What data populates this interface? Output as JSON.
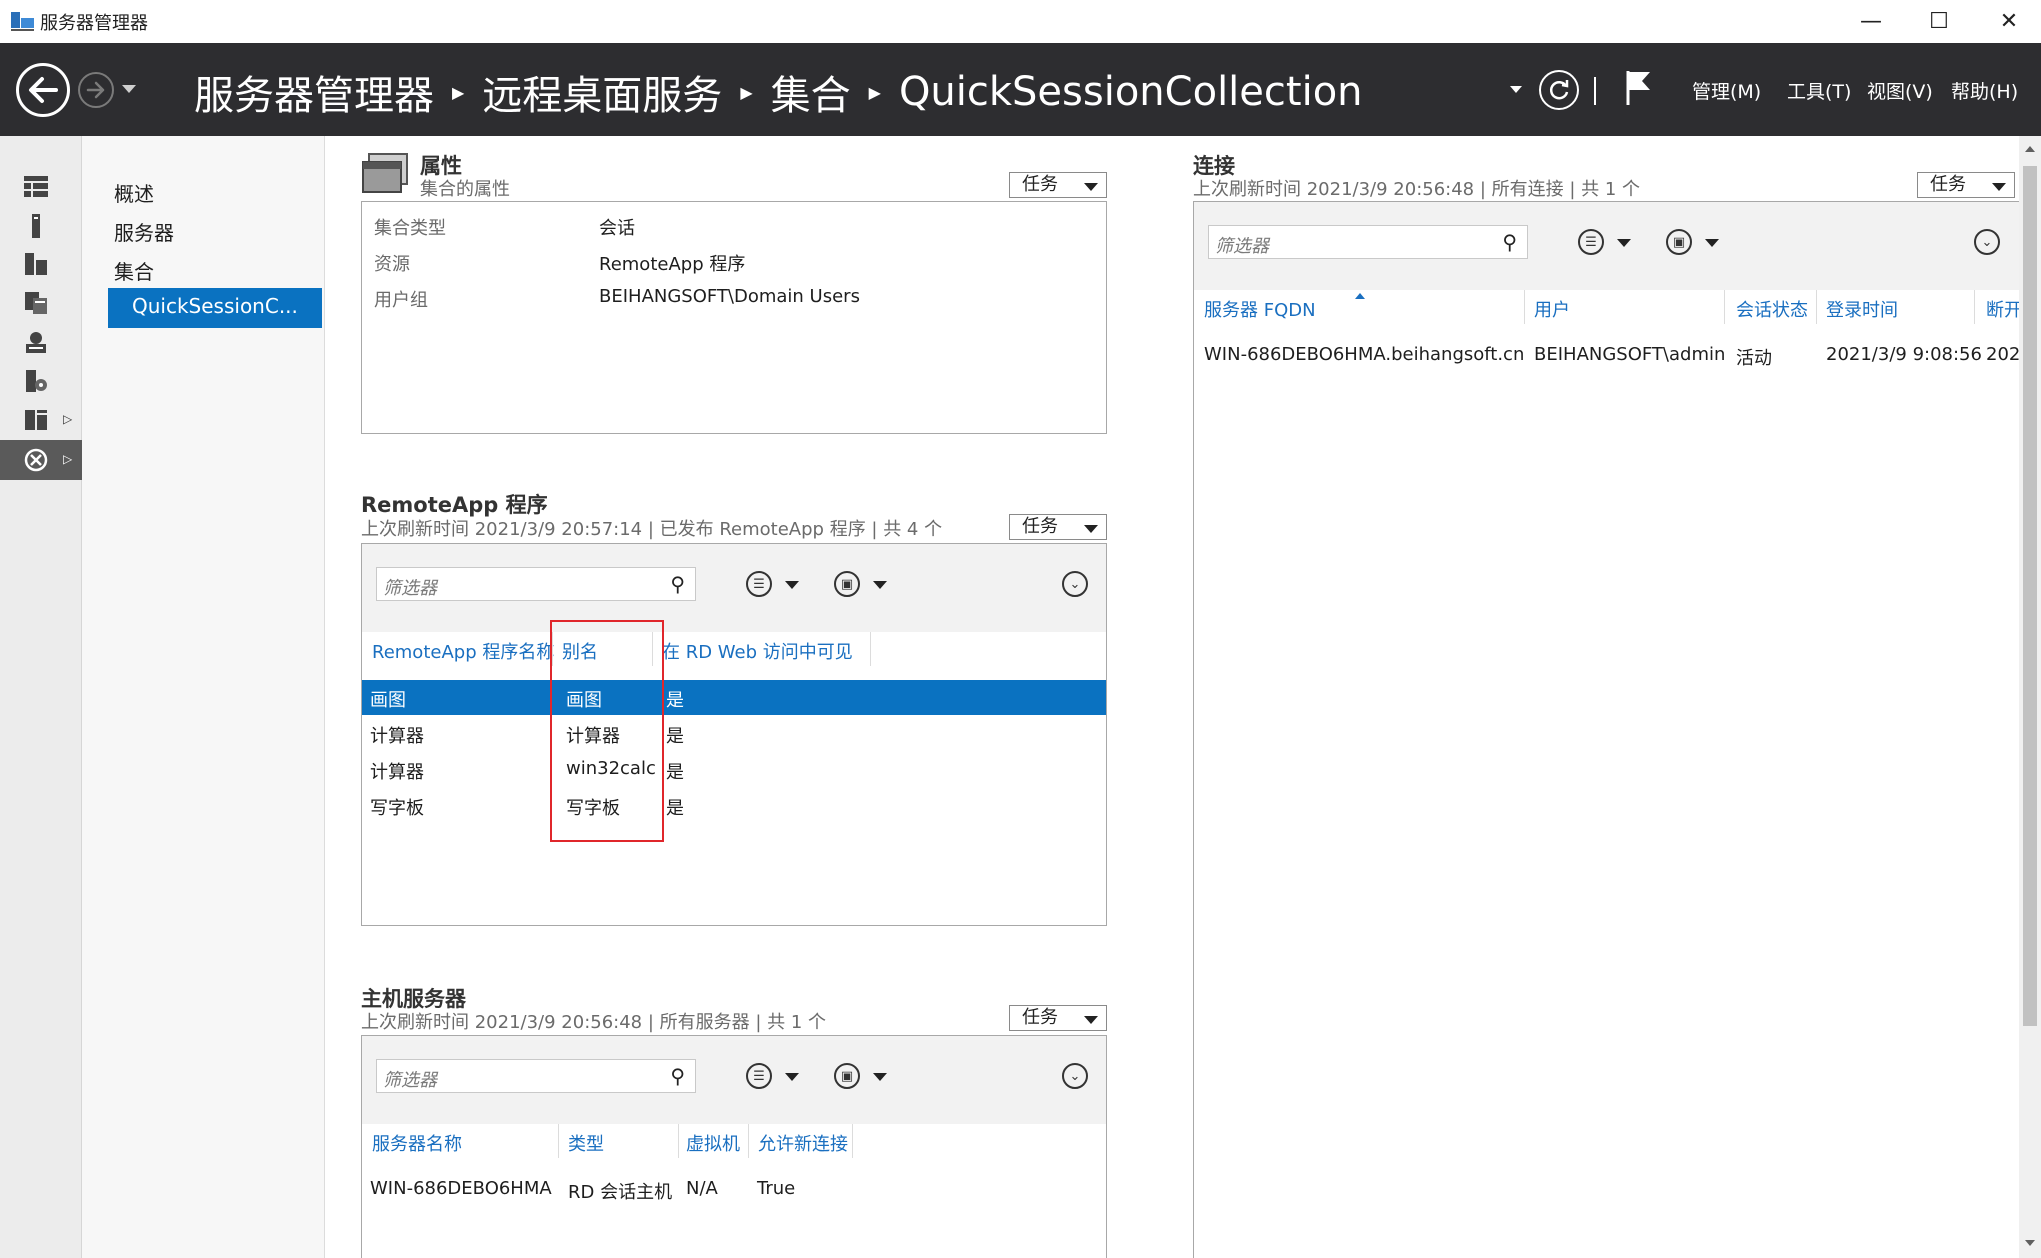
{
  "window": {
    "title": "服务器管理器",
    "controls": {
      "minimize": "—",
      "maximize": "☐",
      "close": "✕"
    }
  },
  "header": {
    "breadcrumbs": [
      "服务器管理器",
      "远程桌面服务",
      "集合",
      "QuickSessionCollection"
    ],
    "menu": [
      "管理(M)",
      "工具(T)",
      "视图(V)",
      "帮助(H)"
    ]
  },
  "nav": {
    "items": [
      "概述",
      "服务器",
      "集合",
      "QuickSessionC..."
    ],
    "active_index": 3
  },
  "properties": {
    "title": "属性",
    "subtitle": "集合的属性",
    "task_label": "任务",
    "rows": [
      {
        "label": "集合类型",
        "value": "会话"
      },
      {
        "label": "资源",
        "value": "RemoteApp 程序"
      },
      {
        "label": "用户组",
        "value": "BEIHANGSOFT\\Domain Users"
      }
    ]
  },
  "remoteapp": {
    "title": "RemoteApp 程序",
    "subtitle": "上次刷新时间 2021/3/9 20:57:14 | 已发布 RemoteApp 程序 | 共 4 个",
    "task_label": "任务",
    "filter_placeholder": "筛选器",
    "columns": [
      "RemoteApp 程序名称",
      "别名",
      "在 RD Web 访问中可见"
    ],
    "rows": [
      [
        "画图",
        "画图",
        "是"
      ],
      [
        "计算器",
        "计算器",
        "是"
      ],
      [
        "计算器",
        "win32calc",
        "是"
      ],
      [
        "写字板",
        "写字板",
        "是"
      ]
    ],
    "selected_row": 0
  },
  "hosts": {
    "title": "主机服务器",
    "subtitle": "上次刷新时间 2021/3/9 20:56:48 | 所有服务器 | 共 1 个",
    "task_label": "任务",
    "filter_placeholder": "筛选器",
    "columns": [
      "服务器名称",
      "类型",
      "虚拟机",
      "允许新连接"
    ],
    "rows": [
      [
        "WIN-686DEBO6HMA",
        "RD 会话主机",
        "N/A",
        "True"
      ]
    ]
  },
  "connections": {
    "title": "连接",
    "subtitle": "上次刷新时间 2021/3/9 20:56:48 | 所有连接 | 共 1 个",
    "task_label": "任务",
    "filter_placeholder": "筛选器",
    "columns": [
      "服务器 FQDN",
      "用户",
      "会话状态",
      "登录时间",
      "断开"
    ],
    "rows": [
      [
        "WIN-686DEBO6HMA.beihangsoft.cn",
        "BEIHANGSOFT\\admin",
        "活动",
        "2021/3/9 9:08:56",
        "202"
      ]
    ]
  },
  "colors": {
    "header_bg": "#2d2d30",
    "accent": "#0a72c1",
    "link": "#1a6fc0",
    "highlight": "#e0262b"
  }
}
